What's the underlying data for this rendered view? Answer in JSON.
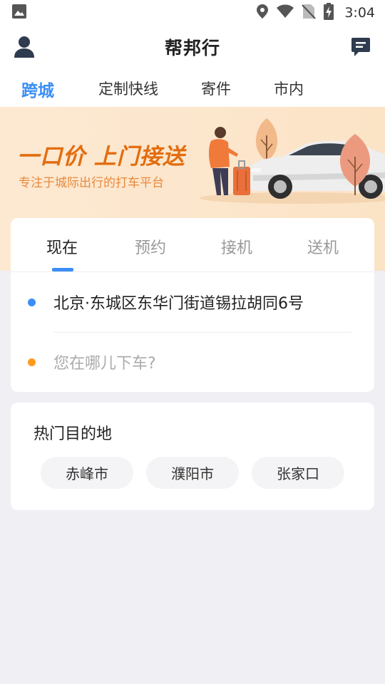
{
  "status_bar": {
    "time": "3:04",
    "icons": [
      "image-icon",
      "location-icon",
      "wifi-icon",
      "no-sim-icon",
      "battery-charging-icon"
    ]
  },
  "header": {
    "title": "帮邦行",
    "left_icon": "user-icon",
    "right_icon": "message-icon"
  },
  "top_tabs": [
    {
      "label": "跨城",
      "active": true
    },
    {
      "label": "定制快线",
      "active": false
    },
    {
      "label": "寄件",
      "active": false
    },
    {
      "label": "市内",
      "active": false
    }
  ],
  "banner": {
    "headline": "一口价 上门接送",
    "subline": "专注于城际出行的打车平台"
  },
  "booking": {
    "tabs": [
      {
        "label": "现在",
        "active": true
      },
      {
        "label": "预约",
        "active": false
      },
      {
        "label": "接机",
        "active": false
      },
      {
        "label": "送机",
        "active": false
      }
    ],
    "from": "北京·东城区东华门街道锡拉胡同6号",
    "to_placeholder": "您在哪儿下车?",
    "colors": {
      "from_dot": "#3a8ef6",
      "to_dot": "#ff9a1f"
    }
  },
  "hot_destinations": {
    "title": "热门目的地",
    "items": [
      "赤峰市",
      "濮阳市",
      "张家口"
    ]
  },
  "colors": {
    "accent": "#3a8ef6",
    "banner_orange": "#e26d0e",
    "page_bg": "#f0eff4"
  }
}
